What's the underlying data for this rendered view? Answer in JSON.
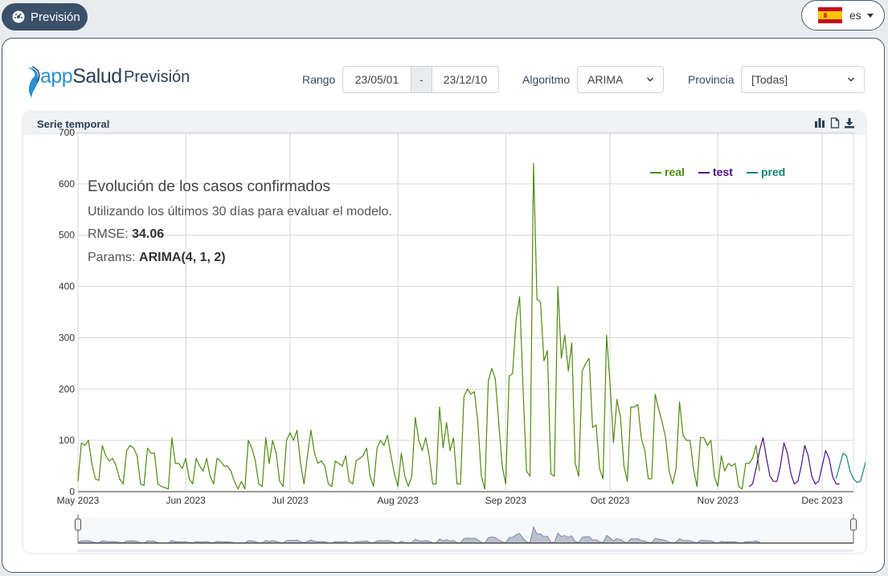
{
  "nav": {
    "prevision_button": "Previsión"
  },
  "lang": {
    "code": "es",
    "flag": "spain-flag-icon"
  },
  "header": {
    "logo_prefix": "app",
    "logo_suffix": "Salud",
    "title": "Previsión",
    "range_label": "Rango",
    "date_from": "23/05/01",
    "date_sep": "-",
    "date_to": "23/12/10",
    "algorithm_label": "Algoritmo",
    "algorithm_value": "ARIMA",
    "province_label": "Provincia",
    "province_value": "[Todas]"
  },
  "card": {
    "title": "Serie temporal",
    "tools": [
      "bar-chart-icon",
      "file-icon",
      "download-icon"
    ]
  },
  "chart_data": {
    "type": "line",
    "title": "Evolución de los casos confirmados",
    "subtitle": "Utilizando los últimos 30 días para evaluar el modelo.",
    "rmse_label": "RMSE:",
    "rmse_value": "34.06",
    "params_label": "Params:",
    "params_value": "ARIMA(4, 1, 2)",
    "ylim": [
      0,
      700
    ],
    "yticks": [
      0,
      100,
      200,
      300,
      400,
      500,
      600,
      700
    ],
    "x_start": "2023-05-01",
    "x_end": "2023-12-10",
    "xticks": [
      {
        "date": "2023-05-01",
        "label": "May 2023"
      },
      {
        "date": "2023-06-01",
        "label": "Jun 2023"
      },
      {
        "date": "2023-07-01",
        "label": "Jul 2023"
      },
      {
        "date": "2023-08-01",
        "label": "Aug 2023"
      },
      {
        "date": "2023-09-01",
        "label": "Sep 2023"
      },
      {
        "date": "2023-10-01",
        "label": "Oct 2023"
      },
      {
        "date": "2023-11-01",
        "label": "Nov 2023"
      },
      {
        "date": "2023-12-01",
        "label": "Dec 2023"
      }
    ],
    "legend_position": "top-right",
    "grid": true,
    "series": [
      {
        "name": "real",
        "color": "#4f8a10",
        "start": "2023-05-01",
        "values": [
          20,
          95,
          90,
          100,
          55,
          25,
          22,
          90,
          70,
          60,
          65,
          50,
          25,
          15,
          80,
          90,
          85,
          70,
          15,
          12,
          85,
          75,
          75,
          15,
          10,
          8,
          5,
          105,
          55,
          55,
          45,
          65,
          25,
          15,
          65,
          50,
          40,
          65,
          30,
          15,
          65,
          60,
          50,
          50,
          40,
          20,
          5,
          20,
          5,
          100,
          85,
          60,
          15,
          10,
          105,
          55,
          100,
          75,
          20,
          10,
          100,
          115,
          100,
          120,
          55,
          15,
          70,
          120,
          75,
          55,
          60,
          50,
          15,
          10,
          60,
          55,
          50,
          70,
          20,
          15,
          60,
          65,
          70,
          85,
          30,
          10,
          85,
          100,
          90,
          110,
          70,
          35,
          10,
          75,
          30,
          10,
          30,
          145,
          100,
          80,
          105,
          70,
          15,
          15,
          165,
          85,
          135,
          80,
          105,
          15,
          15,
          185,
          200,
          190,
          195,
          135,
          30,
          5,
          215,
          240,
          220,
          135,
          50,
          15,
          225,
          230,
          335,
          380,
          200,
          40,
          30,
          640,
          375,
          370,
          255,
          275,
          35,
          30,
          400,
          260,
          305,
          235,
          290,
          55,
          30,
          235,
          250,
          260,
          125,
          130,
          45,
          25,
          305,
          210,
          95,
          180,
          145,
          50,
          20,
          165,
          165,
          170,
          105,
          80,
          25,
          25,
          190,
          160,
          135,
          105,
          40,
          15,
          45,
          175,
          110,
          100,
          100,
          45,
          10,
          105,
          105,
          90,
          100,
          30,
          10,
          70,
          40,
          55,
          50,
          55,
          10,
          5,
          55,
          55,
          65,
          90,
          40
        ],
        "visible": true
      },
      {
        "name": "test",
        "color": "#4b0f82",
        "start": "2023-11-10",
        "values": [
          10,
          15,
          45,
          80,
          105,
          65,
          30,
          20,
          20,
          50,
          95,
          75,
          35,
          15,
          20,
          50,
          90,
          70,
          30,
          15,
          20,
          50,
          80,
          65,
          30,
          15,
          15
        ],
        "visible": true
      },
      {
        "name": "pred",
        "color": "#14857a",
        "start": "2023-12-05",
        "values": [
          25,
          50,
          75,
          70,
          40,
          25,
          18,
          20,
          45,
          70
        ],
        "visible": true
      }
    ]
  }
}
